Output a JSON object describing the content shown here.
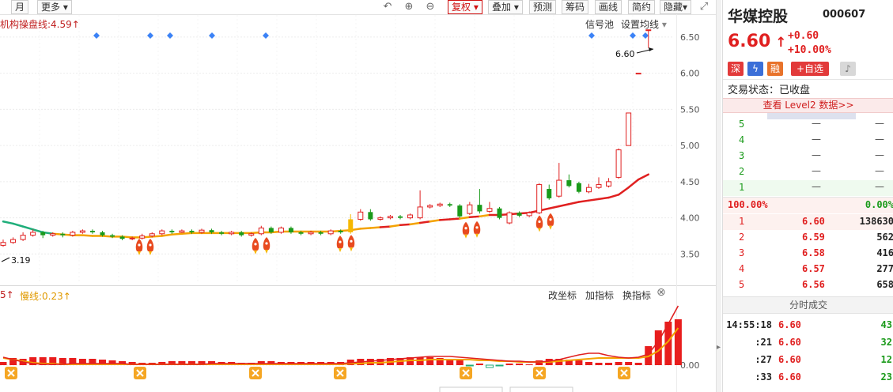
{
  "toolbar": {
    "month": "月",
    "more": "更多",
    "adjust": "复权",
    "overlay": "叠加",
    "predict": "预测",
    "chips": "筹码",
    "draw": "画线",
    "simple": "简约",
    "hide": "隐藏"
  },
  "chart": {
    "indicator_label": "机构操盘线:4.59",
    "signal_pool": "信号池",
    "set_ma": "设置均线",
    "price_marker": "6.60",
    "low_marker": "3.19",
    "y_ticks": [
      "6.50",
      "6.00",
      "5.50",
      "5.00",
      "4.50",
      "4.00",
      "3.50"
    ],
    "sub_left_label": "5",
    "slow_line_label": "慢线:0.23",
    "change_coord": "改坐标",
    "add_indicator": "加指标",
    "switch_indicator": "换指标",
    "sub_zero": "0.00"
  },
  "chart_data": {
    "type": "candlestick",
    "ylim": [
      3.1,
      6.75
    ],
    "y_ticks": [
      6.5,
      6.0,
      5.5,
      5.0,
      4.5,
      4.0,
      3.5
    ],
    "grid": true,
    "candles": [
      {
        "o": 3.62,
        "c": 3.66,
        "h": 3.7,
        "l": 3.6
      },
      {
        "o": 3.66,
        "c": 3.7,
        "h": 3.73,
        "l": 3.64
      },
      {
        "o": 3.7,
        "c": 3.76,
        "h": 3.8,
        "l": 3.68
      },
      {
        "o": 3.76,
        "c": 3.8,
        "h": 3.84,
        "l": 3.74
      },
      {
        "o": 3.8,
        "c": 3.76,
        "h": 3.82,
        "l": 3.72
      },
      {
        "o": 3.76,
        "c": 3.78,
        "h": 3.8,
        "l": 3.74
      },
      {
        "o": 3.78,
        "c": 3.76,
        "h": 3.8,
        "l": 3.73
      },
      {
        "o": 3.76,
        "c": 3.8,
        "h": 3.82,
        "l": 3.74
      },
      {
        "o": 3.8,
        "c": 3.82,
        "h": 3.84,
        "l": 3.78
      },
      {
        "o": 3.82,
        "c": 3.8,
        "h": 3.84,
        "l": 3.78
      },
      {
        "o": 3.8,
        "c": 3.76,
        "h": 3.82,
        "l": 3.74
      },
      {
        "o": 3.76,
        "c": 3.74,
        "h": 3.78,
        "l": 3.72
      },
      {
        "o": 3.74,
        "c": 3.71,
        "h": 3.76,
        "l": 3.69
      },
      {
        "o": 3.71,
        "c": 3.72,
        "h": 3.74,
        "l": 3.69
      },
      {
        "o": 3.72,
        "c": 3.75,
        "h": 3.78,
        "l": 3.7
      },
      {
        "o": 3.75,
        "c": 3.78,
        "h": 3.8,
        "l": 3.73
      },
      {
        "o": 3.78,
        "c": 3.82,
        "h": 3.84,
        "l": 3.76
      },
      {
        "o": 3.82,
        "c": 3.8,
        "h": 3.84,
        "l": 3.78
      },
      {
        "o": 3.8,
        "c": 3.82,
        "h": 3.84,
        "l": 3.79
      },
      {
        "o": 3.82,
        "c": 3.8,
        "h": 3.84,
        "l": 3.78
      },
      {
        "o": 3.8,
        "c": 3.83,
        "h": 3.85,
        "l": 3.78
      },
      {
        "o": 3.83,
        "c": 3.8,
        "h": 3.85,
        "l": 3.78
      },
      {
        "o": 3.8,
        "c": 3.78,
        "h": 3.82,
        "l": 3.76
      },
      {
        "o": 3.78,
        "c": 3.8,
        "h": 3.82,
        "l": 3.76
      },
      {
        "o": 3.8,
        "c": 3.76,
        "h": 3.82,
        "l": 3.74
      },
      {
        "o": 3.76,
        "c": 3.78,
        "h": 3.8,
        "l": 3.74
      },
      {
        "o": 3.78,
        "c": 3.86,
        "h": 3.89,
        "l": 3.76
      },
      {
        "o": 3.86,
        "c": 3.8,
        "h": 3.88,
        "l": 3.78
      },
      {
        "o": 3.8,
        "c": 3.86,
        "h": 3.88,
        "l": 3.78
      },
      {
        "o": 3.86,
        "c": 3.8,
        "h": 3.88,
        "l": 3.78
      },
      {
        "o": 3.8,
        "c": 3.78,
        "h": 3.82,
        "l": 3.76
      },
      {
        "o": 3.78,
        "c": 3.8,
        "h": 3.82,
        "l": 3.76
      },
      {
        "o": 3.8,
        "c": 3.78,
        "h": 3.82,
        "l": 3.76
      },
      {
        "o": 3.78,
        "c": 3.82,
        "h": 3.84,
        "l": 3.76
      },
      {
        "o": 3.82,
        "c": 3.8,
        "h": 3.84,
        "l": 3.78
      },
      {
        "o": 3.8,
        "c": 3.98,
        "h": 4.05,
        "l": 3.78
      },
      {
        "o": 3.98,
        "c": 4.08,
        "h": 4.12,
        "l": 3.96
      },
      {
        "o": 4.08,
        "c": 3.98,
        "h": 4.12,
        "l": 3.96
      },
      {
        "o": 3.98,
        "c": 4.0,
        "h": 4.02,
        "l": 3.96
      },
      {
        "o": 4.0,
        "c": 4.02,
        "h": 4.04,
        "l": 3.98
      },
      {
        "o": 4.02,
        "c": 4.0,
        "h": 4.04,
        "l": 3.98
      },
      {
        "o": 4.0,
        "c": 4.04,
        "h": 4.06,
        "l": 3.98
      },
      {
        "o": 4.0,
        "c": 4.15,
        "h": 4.38,
        "l": 3.98
      },
      {
        "o": 4.15,
        "c": 4.17,
        "h": 4.19,
        "l": 4.13
      },
      {
        "o": 4.17,
        "c": 4.19,
        "h": 4.21,
        "l": 4.15
      },
      {
        "o": 4.19,
        "c": 4.17,
        "h": 4.21,
        "l": 4.15
      },
      {
        "o": 4.17,
        "c": 4.02,
        "h": 4.19,
        "l": 4.0
      },
      {
        "o": 4.06,
        "c": 4.18,
        "h": 4.22,
        "l": 4.04
      },
      {
        "o": 4.18,
        "c": 4.09,
        "h": 4.4,
        "l": 4.06
      },
      {
        "o": 4.09,
        "c": 4.13,
        "h": 4.22,
        "l": 4.07
      },
      {
        "o": 4.13,
        "c": 4.0,
        "h": 4.15,
        "l": 3.98
      },
      {
        "o": 3.93,
        "c": 4.07,
        "h": 4.09,
        "l": 3.91
      },
      {
        "o": 4.07,
        "c": 4.03,
        "h": 4.09,
        "l": 4.01
      },
      {
        "o": 4.03,
        "c": 4.07,
        "h": 4.09,
        "l": 4.01
      },
      {
        "o": 4.07,
        "c": 4.46,
        "h": 4.48,
        "l": 4.05
      },
      {
        "o": 4.4,
        "c": 4.27,
        "h": 4.46,
        "l": 4.25
      },
      {
        "o": 4.3,
        "c": 4.52,
        "h": 4.76,
        "l": 4.28
      },
      {
        "o": 4.52,
        "c": 4.44,
        "h": 4.6,
        "l": 4.42
      },
      {
        "o": 4.48,
        "c": 4.36,
        "h": 4.5,
        "l": 4.34
      },
      {
        "o": 4.36,
        "c": 4.42,
        "h": 4.47,
        "l": 4.34
      },
      {
        "o": 4.42,
        "c": 4.46,
        "h": 4.56,
        "l": 4.4
      },
      {
        "o": 4.44,
        "c": 4.5,
        "h": 4.55,
        "l": 4.42
      },
      {
        "o": 4.56,
        "c": 4.94,
        "h": 4.96,
        "l": 4.54
      },
      {
        "o": 5.0,
        "c": 5.45,
        "h": 5.45,
        "l": 5.0
      },
      {
        "o": 6.0,
        "c": 6.0,
        "h": 6.0,
        "l": 6.0
      },
      {
        "o": 6.6,
        "c": 6.6,
        "h": 6.6,
        "l": 6.35
      }
    ],
    "ma_line": [
      3.95,
      3.92,
      3.88,
      3.84,
      3.8,
      3.78,
      3.77,
      3.76,
      3.76,
      3.75,
      3.75,
      3.74,
      3.74,
      3.73,
      3.73,
      3.74,
      3.75,
      3.77,
      3.78,
      3.79,
      3.79,
      3.79,
      3.79,
      3.79,
      3.79,
      3.79,
      3.8,
      3.8,
      3.81,
      3.81,
      3.81,
      3.81,
      3.81,
      3.81,
      3.82,
      3.83,
      3.85,
      3.86,
      3.87,
      3.88,
      3.9,
      3.91,
      3.93,
      3.95,
      3.97,
      3.98,
      3.99,
      4.01,
      4.02,
      4.04,
      4.04,
      4.05,
      4.06,
      4.07,
      4.1,
      4.13,
      4.16,
      4.19,
      4.22,
      4.24,
      4.26,
      4.28,
      4.32,
      4.42,
      4.53,
      4.6
    ]
  },
  "side": {
    "name": "华媒控股",
    "code": "000607",
    "price": "6.60",
    "change": "+0.60",
    "change_pct": "+10.00%",
    "tag_shen": "深",
    "tag_rong": "融",
    "add_watch": "+自选",
    "status": "交易状态：已收盘",
    "level2": "查看 Level2 数据>>",
    "sell_levels": [
      "5",
      "4",
      "3",
      "2",
      "1"
    ],
    "dash": "—",
    "ratio_left": "100.00%",
    "ratio_right": "0.00%",
    "buy": [
      {
        "lvl": "1",
        "price": "6.60",
        "vol": "138630"
      },
      {
        "lvl": "2",
        "price": "6.59",
        "vol": "562"
      },
      {
        "lvl": "3",
        "price": "6.58",
        "vol": "416"
      },
      {
        "lvl": "4",
        "price": "6.57",
        "vol": "277"
      },
      {
        "lvl": "5",
        "price": "6.56",
        "vol": "658"
      }
    ],
    "ticks_title": "分时成交",
    "ticks": [
      {
        "time": "14:55:18",
        "price": "6.60",
        "vol": "43"
      },
      {
        "time": ":21",
        "price": "6.60",
        "vol": "32"
      },
      {
        "time": ":27",
        "price": "6.60",
        "vol": "12"
      },
      {
        "time": ":33",
        "price": "6.60",
        "vol": "23"
      }
    ]
  }
}
